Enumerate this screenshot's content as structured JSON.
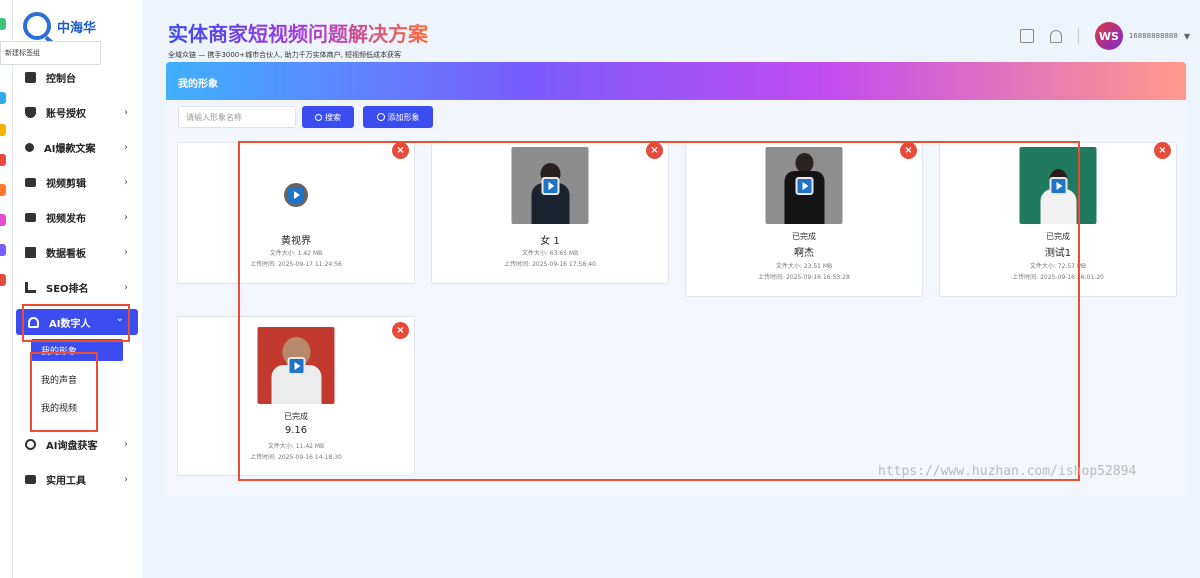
{
  "app": {
    "logo_text": "中海华",
    "tooltip": "新建标签组"
  },
  "header": {
    "title": "实体商家短视频问题解决方案",
    "subtitle": "全域众链 — 携手3000+城市合伙人, 助力千万实体商户, 短视频低成本获客",
    "user_initials": "WS",
    "username": "16888888888",
    "caret": "▼"
  },
  "sidebar": {
    "items": [
      {
        "label": "控制台",
        "icon": "monitor-icon"
      },
      {
        "label": "账号授权",
        "icon": "shield-icon",
        "chev": "›"
      },
      {
        "label": "AI爆款文案",
        "icon": "bulb-icon",
        "chev": "›"
      },
      {
        "label": "视频剪辑",
        "icon": "video-icon",
        "chev": "›"
      },
      {
        "label": "视频发布",
        "icon": "publish-icon",
        "chev": "›"
      },
      {
        "label": "数据看板",
        "icon": "dashboard-icon",
        "chev": "›"
      },
      {
        "label": "SEO排名",
        "icon": "chart-icon",
        "chev": "›"
      },
      {
        "label": "AI数字人",
        "icon": "person-icon",
        "chev": "⌄"
      }
    ],
    "sub_items": [
      {
        "label": "我的形象"
      },
      {
        "label": "我的声音"
      },
      {
        "label": "我的视频"
      }
    ],
    "items_after": [
      {
        "label": "AI询盘获客",
        "icon": "headset-icon",
        "chev": "›"
      },
      {
        "label": "实用工具",
        "icon": "toolbox-icon",
        "chev": "›"
      }
    ]
  },
  "panel": {
    "title": "我的形象",
    "search_placeholder": "请输入形象名称",
    "search_button": "搜索",
    "add_button": "添加形象"
  },
  "cards": [
    {
      "status": "",
      "name": "黄视界",
      "size": "文件大小: 1.42 MB",
      "time": "上传时间: 2025-09-17 11:24:56"
    },
    {
      "status": "",
      "name": "女 1",
      "size": "文件大小: 63.65 MB",
      "time": "上传时间: 2025-09-16 17:58:40"
    },
    {
      "status": "已完成",
      "name": "啊杰",
      "size": "文件大小: 23.51 MB",
      "time": "上传时间: 2025-09-16 16:53:28"
    },
    {
      "status": "已完成",
      "name": "测试1",
      "size": "文件大小: 72.57 MB",
      "time": "上传时间: 2025-09-16 16:01:20"
    },
    {
      "status": "已完成",
      "name": "9.16",
      "size": "文件大小: 11.42 MB",
      "time": "上传时间: 2025-09-16 14:18:30"
    }
  ],
  "delete_glyph": "×",
  "watermark": "https://www.huzhan.com/ishop52894",
  "colors": {
    "accent": "#3b4cf0",
    "delete": "#e84b3c",
    "annotation": "#e8502f"
  }
}
